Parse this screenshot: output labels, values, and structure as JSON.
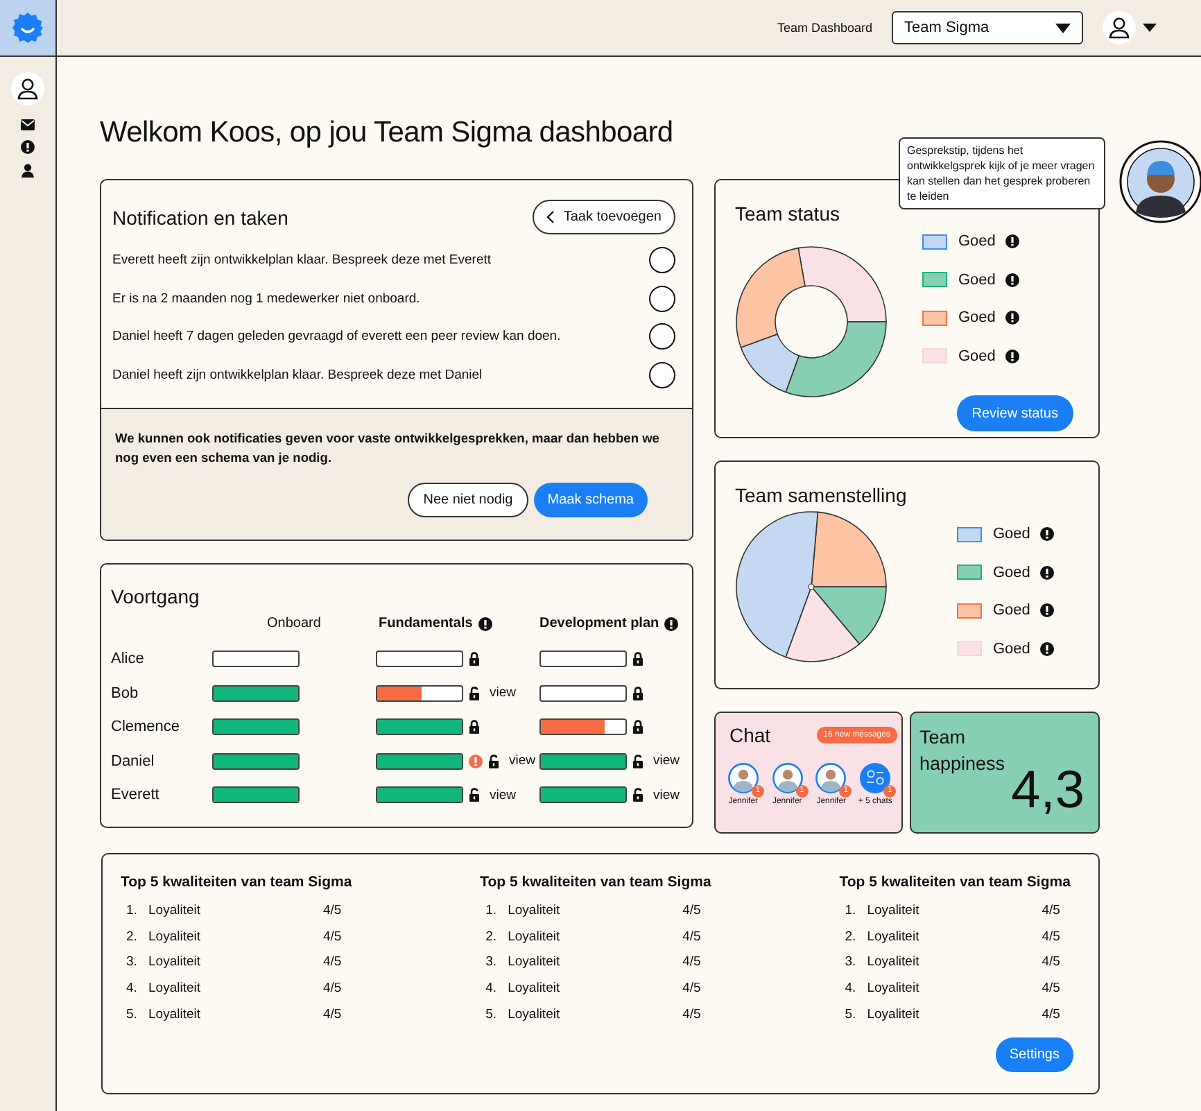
{
  "top_bar": {
    "link": "Team Dashboard",
    "team_select": {
      "value": "Team Sigma"
    }
  },
  "title": "Welkom Koos, op jou Team Sigma dashboard",
  "tip": "Gesprekstip, tijdens het ontwikkelgsprek kijk of je meer vragen kan stellen dan het gesprek proberen te leiden",
  "notifications": {
    "title": "Notification en taken",
    "add_button": "Taak toevoegen",
    "items": [
      {
        "text": "Everett heeft zijn ontwikkelplan klaar. Bespreek deze met Everett",
        "checked": false
      },
      {
        "text": "Er is na 2 maanden nog 1 medewerker niet onboard.",
        "checked": false
      },
      {
        "text": "Daniel heeft 7 dagen geleden gevraagd of everett een peer review kan doen.",
        "checked": false
      },
      {
        "text": "Daniel heeft zijn ontwikkelplan klaar. Bespreek deze met Daniel",
        "checked": false
      }
    ],
    "suggestion": {
      "text": "We kunnen ook notificaties geven voor vaste ontwikkelgesprekken, maar dan hebben we nog even een schema van je nodig.",
      "buttons": [
        {
          "label": "Nee niet nodig",
          "kind": "secondary"
        },
        {
          "label": "Maak schema",
          "kind": "primary"
        }
      ]
    }
  },
  "progress": {
    "title": "Voortgang",
    "columns": [
      {
        "label": "Onboard",
        "info": false
      },
      {
        "label": "Fundamentals",
        "info": true
      },
      {
        "label": "Development plan",
        "info": true
      }
    ],
    "rows": [
      {
        "name": "Alice",
        "cells": [
          {
            "level": 0
          },
          {
            "level": 0,
            "locked": true
          },
          {
            "level": 0,
            "locked": true
          }
        ]
      },
      {
        "name": "Bob",
        "cells": [
          {
            "level": 1
          },
          {
            "level": 0.52,
            "locked": false,
            "link": "view"
          },
          {
            "level": 0,
            "locked": true
          }
        ]
      },
      {
        "name": "Clemence",
        "cells": [
          {
            "level": 1
          },
          {
            "level": 1,
            "locked": true
          },
          {
            "level": 0.75,
            "locked": true
          }
        ]
      },
      {
        "name": "Daniel",
        "cells": [
          {
            "level": 1
          },
          {
            "level": 1,
            "warning": true,
            "locked": false,
            "link": "view"
          },
          {
            "level": 1,
            "locked": false,
            "link": "view"
          }
        ]
      },
      {
        "name": "Everett",
        "cells": [
          {
            "level": 1
          },
          {
            "level": 1,
            "locked": false,
            "link": "view"
          },
          {
            "level": 1,
            "locked": false,
            "link": "view"
          }
        ]
      }
    ]
  },
  "team_status": {
    "title": "Team status",
    "legend": [
      {
        "label": "Goed",
        "color": "#c5d8f1"
      },
      {
        "label": "Goed",
        "color": "#86cfb3"
      },
      {
        "label": "Goed",
        "color": "#fdc4a3"
      },
      {
        "label": "Goed",
        "color": "#f9e1e6"
      }
    ],
    "button": "Review status"
  },
  "team_composition": {
    "title": "Team samenstelling",
    "legend": [
      {
        "label": "Goed",
        "color": "#c5d8f1"
      },
      {
        "label": "Goed",
        "color": "#86cfb3"
      },
      {
        "label": "Goed",
        "color": "#fdc4a3"
      },
      {
        "label": "Goed",
        "color": "#f9e1e6"
      }
    ]
  },
  "chat": {
    "title": "Chat",
    "badge": "16 new messages",
    "contacts": [
      {
        "name": "Jennifer",
        "unread": "1",
        "kind": "person"
      },
      {
        "name": "Jennifer",
        "unread": "1",
        "kind": "person"
      },
      {
        "name": "Jennifer",
        "unread": "1",
        "kind": "person"
      },
      {
        "name": "+ 5 chats",
        "unread": "1",
        "kind": "group"
      }
    ]
  },
  "happiness": {
    "title": "Team happiness",
    "value": "4,3"
  },
  "qualities": {
    "lists": [
      {
        "title": "Top 5 kwaliteiten van team Sigma",
        "items": [
          {
            "rank": "1.",
            "name": "Loyaliteit",
            "score": "4/5"
          },
          {
            "rank": "2.",
            "name": "Loyaliteit",
            "score": "4/5"
          },
          {
            "rank": "3.",
            "name": "Loyaliteit",
            "score": "4/5"
          },
          {
            "rank": "4.",
            "name": "Loyaliteit",
            "score": "4/5"
          },
          {
            "rank": "5.",
            "name": "Loyaliteit",
            "score": "4/5"
          }
        ]
      },
      {
        "title": "Top 5 kwaliteiten van team Sigma",
        "items": [
          {
            "rank": "1.",
            "name": "Loyaliteit",
            "score": "4/5"
          },
          {
            "rank": "2.",
            "name": "Loyaliteit",
            "score": "4/5"
          },
          {
            "rank": "3.",
            "name": "Loyaliteit",
            "score": "4/5"
          },
          {
            "rank": "4.",
            "name": "Loyaliteit",
            "score": "4/5"
          },
          {
            "rank": "5.",
            "name": "Loyaliteit",
            "score": "4/5"
          }
        ]
      },
      {
        "title": "Top 5 kwaliteiten van team Sigma",
        "items": [
          {
            "rank": "1.",
            "name": "Loyaliteit",
            "score": "4/5"
          },
          {
            "rank": "2.",
            "name": "Loyaliteit",
            "score": "4/5"
          },
          {
            "rank": "3.",
            "name": "Loyaliteit",
            "score": "4/5"
          },
          {
            "rank": "4.",
            "name": "Loyaliteit",
            "score": "4/5"
          },
          {
            "rank": "5.",
            "name": "Loyaliteit",
            "score": "4/5"
          }
        ]
      }
    ],
    "button": "Settings"
  }
}
